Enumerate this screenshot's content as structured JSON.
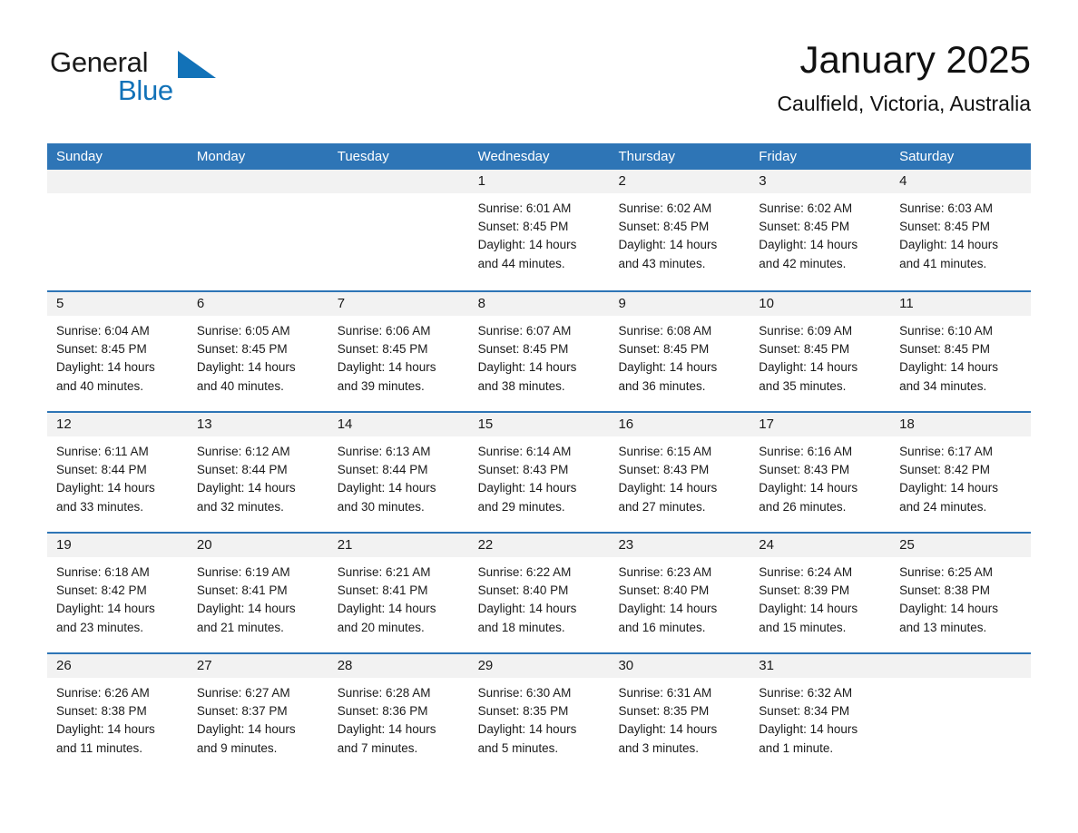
{
  "brand": {
    "word_one": "General",
    "word_two": "Blue",
    "triangle_color": "#1272b8",
    "blue_text_color": "#1272b8"
  },
  "header": {
    "title": "January 2025",
    "subtitle": "Caulfield, Victoria, Australia"
  },
  "colors": {
    "header_bar": "#2e75b6",
    "day_band": "#f2f2f2",
    "week_divider": "#2e75b6",
    "text": "#1a1a1a",
    "page_background": "#ffffff"
  },
  "calendar": {
    "weekdays": [
      "Sunday",
      "Monday",
      "Tuesday",
      "Wednesday",
      "Thursday",
      "Friday",
      "Saturday"
    ],
    "weeks": [
      [
        {
          "day": "",
          "empty": true
        },
        {
          "day": "",
          "empty": true
        },
        {
          "day": "",
          "empty": true
        },
        {
          "day": "1",
          "sunrise": "Sunrise: 6:01 AM",
          "sunset": "Sunset: 8:45 PM",
          "daylight": "Daylight: 14 hours and 44 minutes."
        },
        {
          "day": "2",
          "sunrise": "Sunrise: 6:02 AM",
          "sunset": "Sunset: 8:45 PM",
          "daylight": "Daylight: 14 hours and 43 minutes."
        },
        {
          "day": "3",
          "sunrise": "Sunrise: 6:02 AM",
          "sunset": "Sunset: 8:45 PM",
          "daylight": "Daylight: 14 hours and 42 minutes."
        },
        {
          "day": "4",
          "sunrise": "Sunrise: 6:03 AM",
          "sunset": "Sunset: 8:45 PM",
          "daylight": "Daylight: 14 hours and 41 minutes."
        }
      ],
      [
        {
          "day": "5",
          "sunrise": "Sunrise: 6:04 AM",
          "sunset": "Sunset: 8:45 PM",
          "daylight": "Daylight: 14 hours and 40 minutes."
        },
        {
          "day": "6",
          "sunrise": "Sunrise: 6:05 AM",
          "sunset": "Sunset: 8:45 PM",
          "daylight": "Daylight: 14 hours and 40 minutes."
        },
        {
          "day": "7",
          "sunrise": "Sunrise: 6:06 AM",
          "sunset": "Sunset: 8:45 PM",
          "daylight": "Daylight: 14 hours and 39 minutes."
        },
        {
          "day": "8",
          "sunrise": "Sunrise: 6:07 AM",
          "sunset": "Sunset: 8:45 PM",
          "daylight": "Daylight: 14 hours and 38 minutes."
        },
        {
          "day": "9",
          "sunrise": "Sunrise: 6:08 AM",
          "sunset": "Sunset: 8:45 PM",
          "daylight": "Daylight: 14 hours and 36 minutes."
        },
        {
          "day": "10",
          "sunrise": "Sunrise: 6:09 AM",
          "sunset": "Sunset: 8:45 PM",
          "daylight": "Daylight: 14 hours and 35 minutes."
        },
        {
          "day": "11",
          "sunrise": "Sunrise: 6:10 AM",
          "sunset": "Sunset: 8:45 PM",
          "daylight": "Daylight: 14 hours and 34 minutes."
        }
      ],
      [
        {
          "day": "12",
          "sunrise": "Sunrise: 6:11 AM",
          "sunset": "Sunset: 8:44 PM",
          "daylight": "Daylight: 14 hours and 33 minutes."
        },
        {
          "day": "13",
          "sunrise": "Sunrise: 6:12 AM",
          "sunset": "Sunset: 8:44 PM",
          "daylight": "Daylight: 14 hours and 32 minutes."
        },
        {
          "day": "14",
          "sunrise": "Sunrise: 6:13 AM",
          "sunset": "Sunset: 8:44 PM",
          "daylight": "Daylight: 14 hours and 30 minutes."
        },
        {
          "day": "15",
          "sunrise": "Sunrise: 6:14 AM",
          "sunset": "Sunset: 8:43 PM",
          "daylight": "Daylight: 14 hours and 29 minutes."
        },
        {
          "day": "16",
          "sunrise": "Sunrise: 6:15 AM",
          "sunset": "Sunset: 8:43 PM",
          "daylight": "Daylight: 14 hours and 27 minutes."
        },
        {
          "day": "17",
          "sunrise": "Sunrise: 6:16 AM",
          "sunset": "Sunset: 8:43 PM",
          "daylight": "Daylight: 14 hours and 26 minutes."
        },
        {
          "day": "18",
          "sunrise": "Sunrise: 6:17 AM",
          "sunset": "Sunset: 8:42 PM",
          "daylight": "Daylight: 14 hours and 24 minutes."
        }
      ],
      [
        {
          "day": "19",
          "sunrise": "Sunrise: 6:18 AM",
          "sunset": "Sunset: 8:42 PM",
          "daylight": "Daylight: 14 hours and 23 minutes."
        },
        {
          "day": "20",
          "sunrise": "Sunrise: 6:19 AM",
          "sunset": "Sunset: 8:41 PM",
          "daylight": "Daylight: 14 hours and 21 minutes."
        },
        {
          "day": "21",
          "sunrise": "Sunrise: 6:21 AM",
          "sunset": "Sunset: 8:41 PM",
          "daylight": "Daylight: 14 hours and 20 minutes."
        },
        {
          "day": "22",
          "sunrise": "Sunrise: 6:22 AM",
          "sunset": "Sunset: 8:40 PM",
          "daylight": "Daylight: 14 hours and 18 minutes."
        },
        {
          "day": "23",
          "sunrise": "Sunrise: 6:23 AM",
          "sunset": "Sunset: 8:40 PM",
          "daylight": "Daylight: 14 hours and 16 minutes."
        },
        {
          "day": "24",
          "sunrise": "Sunrise: 6:24 AM",
          "sunset": "Sunset: 8:39 PM",
          "daylight": "Daylight: 14 hours and 15 minutes."
        },
        {
          "day": "25",
          "sunrise": "Sunrise: 6:25 AM",
          "sunset": "Sunset: 8:38 PM",
          "daylight": "Daylight: 14 hours and 13 minutes."
        }
      ],
      [
        {
          "day": "26",
          "sunrise": "Sunrise: 6:26 AM",
          "sunset": "Sunset: 8:38 PM",
          "daylight": "Daylight: 14 hours and 11 minutes."
        },
        {
          "day": "27",
          "sunrise": "Sunrise: 6:27 AM",
          "sunset": "Sunset: 8:37 PM",
          "daylight": "Daylight: 14 hours and 9 minutes."
        },
        {
          "day": "28",
          "sunrise": "Sunrise: 6:28 AM",
          "sunset": "Sunset: 8:36 PM",
          "daylight": "Daylight: 14 hours and 7 minutes."
        },
        {
          "day": "29",
          "sunrise": "Sunrise: 6:30 AM",
          "sunset": "Sunset: 8:35 PM",
          "daylight": "Daylight: 14 hours and 5 minutes."
        },
        {
          "day": "30",
          "sunrise": "Sunrise: 6:31 AM",
          "sunset": "Sunset: 8:35 PM",
          "daylight": "Daylight: 14 hours and 3 minutes."
        },
        {
          "day": "31",
          "sunrise": "Sunrise: 6:32 AM",
          "sunset": "Sunset: 8:34 PM",
          "daylight": "Daylight: 14 hours and 1 minute."
        },
        {
          "day": "",
          "empty": true
        }
      ]
    ]
  }
}
